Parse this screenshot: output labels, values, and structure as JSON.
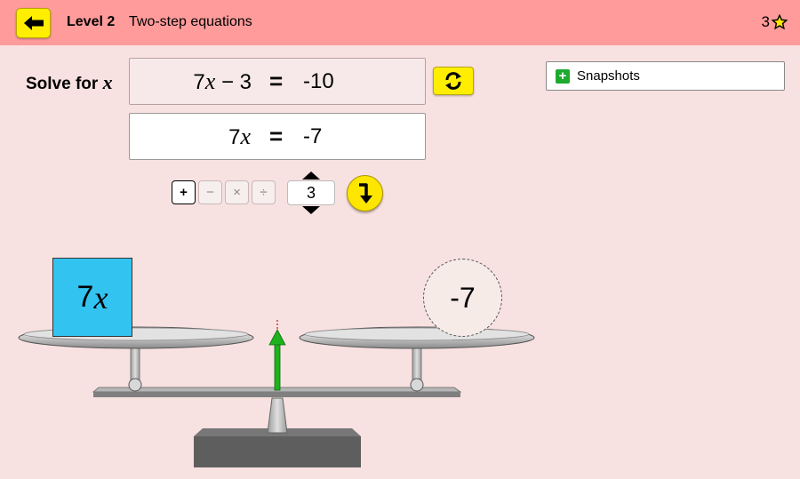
{
  "header": {
    "level_label": "Level 2",
    "level_title": "Two-step equations",
    "stars_count": "3",
    "back_icon": "arrow-left-icon",
    "star_icon": "star-outline-icon"
  },
  "problem": {
    "solve_label": "Solve for",
    "variable": "x",
    "equation": {
      "coef": "7",
      "var": "x",
      "op": "−",
      "const": "3",
      "equals": "=",
      "rhs": "-10"
    }
  },
  "working": {
    "coef": "7",
    "var": "x",
    "equals": "=",
    "rhs": "-7"
  },
  "controls": {
    "operations": [
      "+",
      "−",
      "×",
      "÷"
    ],
    "selected_operation": "+",
    "number_value": "3",
    "refresh_icon": "refresh-icon",
    "apply_icon": "arrow-down-icon"
  },
  "snapshots": {
    "label": "Snapshots",
    "icon": "plus-icon"
  },
  "scale": {
    "left_block": {
      "coef": "7",
      "var": "x"
    },
    "right_value": "-7",
    "colors": {
      "block": "#33c3f0",
      "pointer": "#1db21d",
      "accent": "#ffee00"
    }
  }
}
